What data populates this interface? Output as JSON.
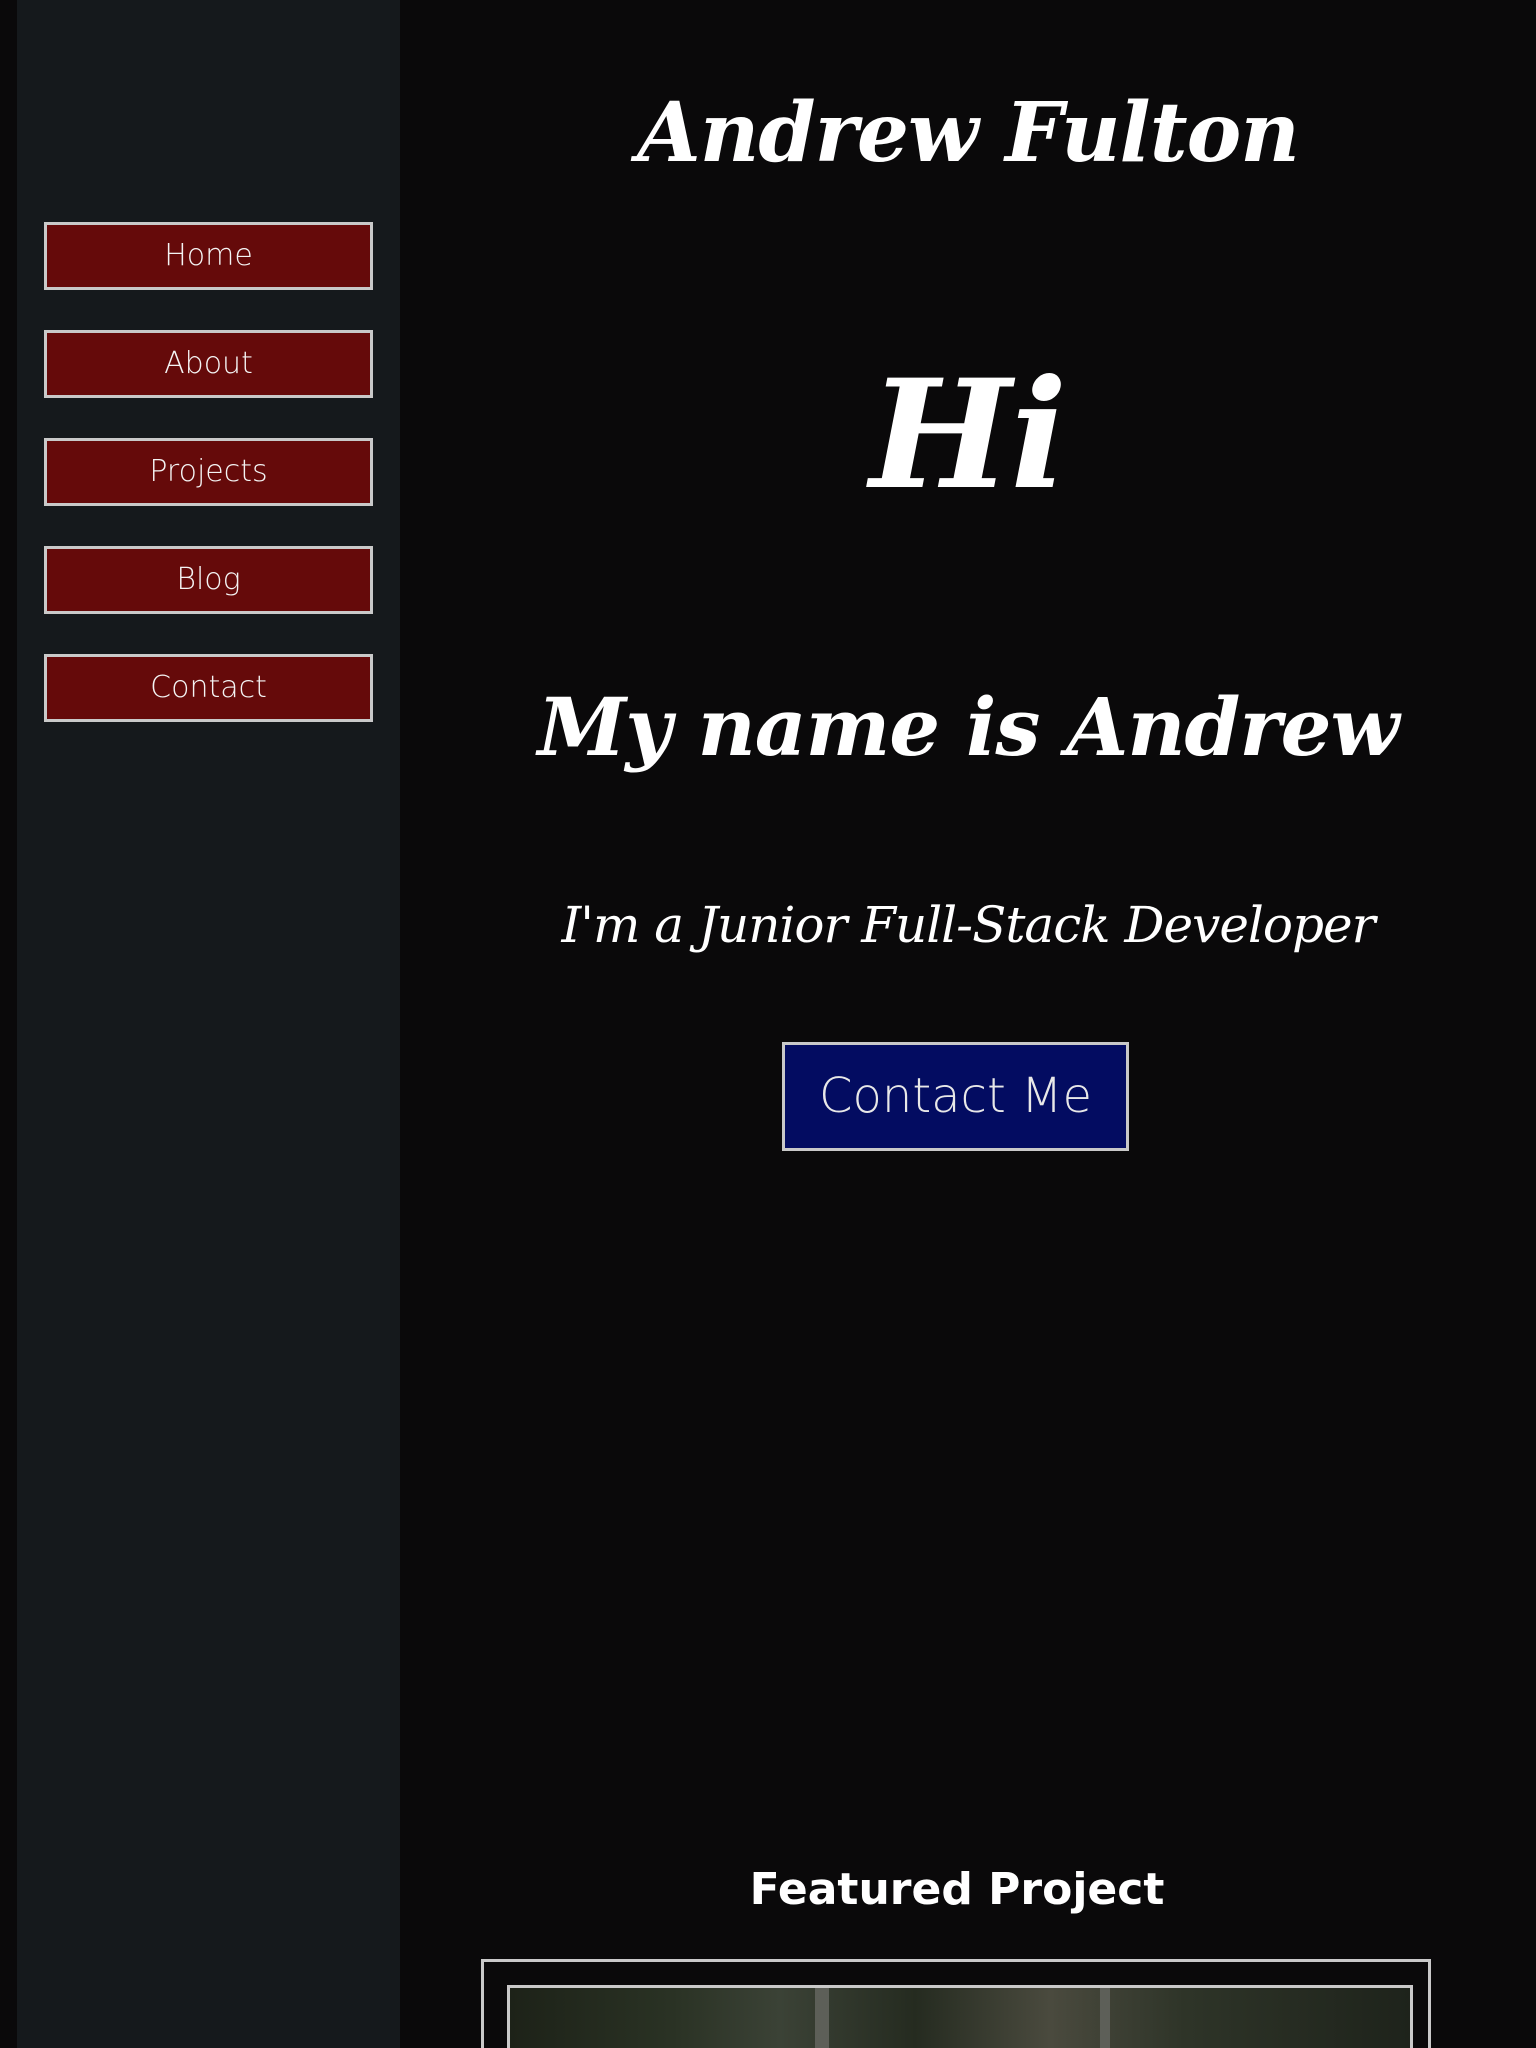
{
  "sidebar": {
    "nav_items": [
      {
        "label": "Home"
      },
      {
        "label": "About"
      },
      {
        "label": "Projects"
      },
      {
        "label": "Blog"
      },
      {
        "label": "Contact"
      }
    ]
  },
  "header": {
    "site_title": "Andrew Fulton"
  },
  "hero": {
    "greeting": "Hi",
    "intro": "My name is Andrew",
    "tagline": "I'm a Junior Full-Stack Developer",
    "cta_label": "Contact Me"
  },
  "featured": {
    "heading": "Featured Project"
  },
  "colors": {
    "page_background": "#0a090a",
    "sidebar_background": "#15191c",
    "nav_button": "#650a0a",
    "cta_button": "#030c61",
    "border": "#c9c9c9"
  }
}
